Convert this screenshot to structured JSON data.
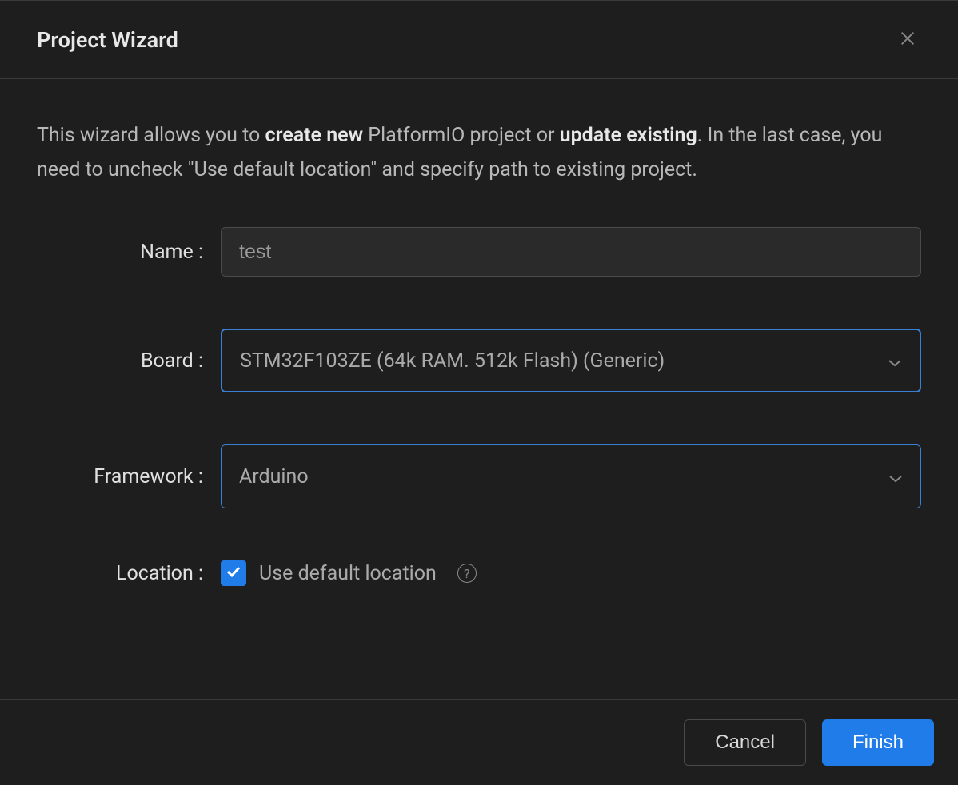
{
  "header": {
    "title": "Project Wizard"
  },
  "description": {
    "part1": "This wizard allows you to ",
    "bold1": "create new",
    "part2": " PlatformIO project or ",
    "bold2": "update existing",
    "part3": ". In the last case, you need to uncheck \"Use default location\" and specify path to existing project."
  },
  "form": {
    "name": {
      "label": "Name :",
      "value": "test"
    },
    "board": {
      "label": "Board :",
      "value": "STM32F103ZE (64k RAM. 512k Flash) (Generic)"
    },
    "framework": {
      "label": "Framework :",
      "value": "Arduino"
    },
    "location": {
      "label": "Location :",
      "checkbox_label": "Use default location",
      "checked": true,
      "help": "?"
    }
  },
  "footer": {
    "cancel": "Cancel",
    "finish": "Finish"
  }
}
